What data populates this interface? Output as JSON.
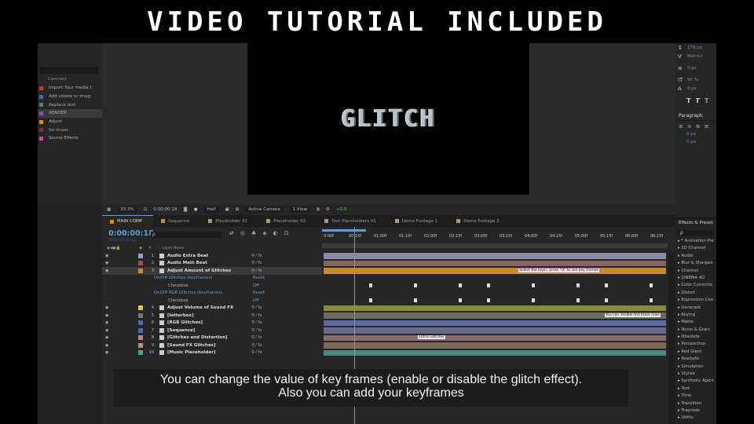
{
  "banner": {
    "title": "VIDEO TUTORIAL INCLUDED"
  },
  "project_panel": {
    "header": "Comment",
    "items": [
      {
        "label": "Import Your media f",
        "color": "#c0392b"
      },
      {
        "label": "Add videos or imag",
        "color": "#4a67b8"
      },
      {
        "label": "Replace text",
        "color": "#4a8f3a"
      },
      {
        "label": "RENDER",
        "color": "#7d4fa6",
        "selected": true
      },
      {
        "label": "Adjust",
        "color": "#d8862a"
      },
      {
        "label": "for music",
        "color": "#8a3030"
      },
      {
        "label": "Sound Effects",
        "color": "#c44aa0"
      }
    ]
  },
  "viewer": {
    "preview_text": "GLITCH",
    "toolbar": {
      "zoom": "33.3%",
      "timecode": "0:00:00:18",
      "resolution": "Half",
      "camera": "Active Camera",
      "view": "1 View",
      "exposure": "+0.0"
    }
  },
  "character_panel": {
    "leading": "276 px",
    "tracking_font": "Metrics",
    "stroke": "0 px",
    "vscale": "90 %",
    "baseline": "0 px",
    "format_buttons": [
      "T",
      "T",
      "T"
    ],
    "paragraph_title": "Paragraph",
    "indent_1": "0 px",
    "indent_2": "0 px"
  },
  "effects_panel": {
    "title": "Effects & Preset",
    "items": [
      "* Animation Pre",
      "3D Channel",
      "Audio",
      "Blur & Sharpen",
      "Channel",
      "CINEMA 4D",
      "Color Correctio",
      "Distort",
      "Expression Con",
      "Generate",
      "Keying",
      "Matte",
      "Noise & Grain",
      "Obsolete",
      "Perspective",
      "Red Giant",
      "Rowbyte",
      "Simulation",
      "Stylize",
      "Synthetic Apert",
      "Text",
      "Time",
      "Transition",
      "Trapcode",
      "Utility"
    ]
  },
  "timeline": {
    "tabs": [
      {
        "label": "MAIN COMP",
        "color": "#d8862a",
        "active": true
      },
      {
        "label": "Sequence",
        "color": "#d8862a"
      },
      {
        "label": "Placeholder 01",
        "color": "#b8956a"
      },
      {
        "label": "Placeholder 02",
        "color": "#b8956a"
      },
      {
        "label": "Text Placeholders 01",
        "color": "#b8956a"
      },
      {
        "label": "Demo Footage 1",
        "color": "#b8956a"
      },
      {
        "label": "Demo Footage 2",
        "color": "#b8956a"
      }
    ],
    "timecode": "0:00:00:18",
    "fps_note": "00018 (25.00 fps)",
    "search_placeholder": "ρ",
    "col_header": "Layer Name",
    "ruler_labels": [
      "0:00f",
      "00:15f",
      "01:00f",
      "01:15f",
      "02:00f",
      "02:15f",
      "03:00f",
      "03:15f",
      "04:00f",
      "04:15f",
      "05:00f",
      "05:15f",
      "06:00f",
      "06:15f"
    ],
    "rows": [
      {
        "kind": "layer",
        "num": "1",
        "name": "Audio Extra Beat",
        "color": "#9a9acc",
        "bar": "#8a8aa8"
      },
      {
        "kind": "layer",
        "num": "2",
        "name": "Audio Main Beat",
        "color": "#a05050",
        "bar": "#8a6262"
      },
      {
        "kind": "layer",
        "num": "3",
        "name": "Adjust Amount of Glitches",
        "color": "#d8862a",
        "bar": "#c98a2a",
        "selected": true,
        "note": "Select the layer, press \"U\" to see key frames"
      },
      {
        "kind": "prop",
        "name": "On/Off Glitches (Keyframes)",
        "value": "Reset"
      },
      {
        "kind": "sub",
        "name": "Checkbox",
        "value": "Off"
      },
      {
        "kind": "prop",
        "name": "On/Off RGB Glitches (Keyframes)",
        "value": "Reset"
      },
      {
        "kind": "sub",
        "name": "Checkbox",
        "value": "Off"
      },
      {
        "kind": "layer",
        "num": "4",
        "name": "Adjust Volume of Sound FX",
        "color": "#d8c84a",
        "bar": "#8a8a3a"
      },
      {
        "kind": "layer",
        "num": "5",
        "name": "[letterbox]",
        "color": "#777777",
        "bar": "#6d6a60",
        "note": "You can disable the black lines"
      },
      {
        "kind": "layer",
        "num": "6",
        "name": "[RGB Glitches]",
        "color": "#4a67b8",
        "bar": "#5b6aa0"
      },
      {
        "kind": "layer",
        "num": "7",
        "name": "[Sequence]",
        "color": "#4a67b8",
        "bar": "#6a6a8a"
      },
      {
        "kind": "layer",
        "num": "8",
        "name": "[Glitches and Distortion]",
        "color": "#c97a9a",
        "bar": "#8a6a6a",
        "note": "100% Glitches"
      },
      {
        "kind": "layer",
        "num": "9",
        "name": "[Sound FX Glitches]",
        "color": "#b8956a",
        "bar": "#7a6a5a"
      },
      {
        "kind": "layer",
        "num": "10",
        "name": "[Music Placeholder]",
        "color": "#4aa0a0",
        "bar": "#4a8888"
      }
    ]
  },
  "subtitle": {
    "line1": "You can change the value of key frames (enable or disable the glitch effect).",
    "line2": "Also you can add your keyframes"
  }
}
